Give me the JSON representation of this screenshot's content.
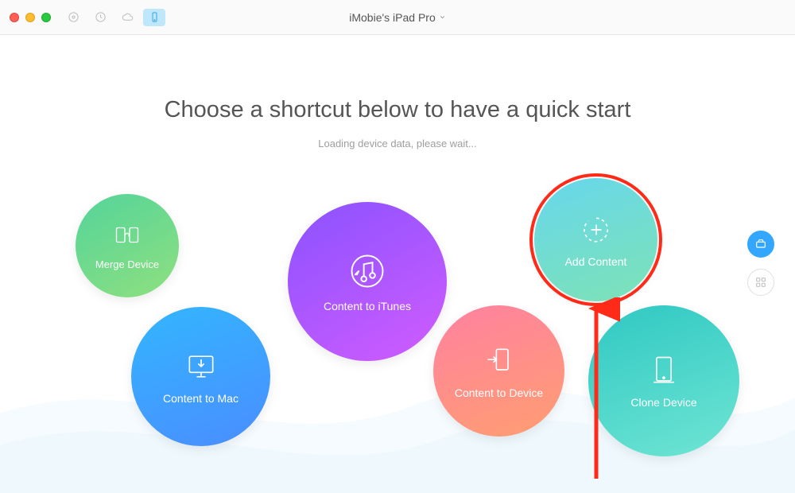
{
  "window": {
    "title": "iMobie's iPad Pro"
  },
  "toolbar": {
    "icons": [
      "disc",
      "history",
      "cloud",
      "device"
    ],
    "active_index": 3
  },
  "main": {
    "heading": "Choose a shortcut below to have a quick start",
    "subhead": "Loading device data, please wait..."
  },
  "bubbles": {
    "merge": {
      "label": "Merge Device"
    },
    "to_mac": {
      "label": "Content to Mac"
    },
    "to_itunes": {
      "label": "Content to iTunes"
    },
    "to_device": {
      "label": "Content to Device"
    },
    "add": {
      "label": "Add Content"
    },
    "clone": {
      "label": "Clone Device"
    }
  },
  "modes": {
    "active_index": 0
  },
  "colors": {
    "accent_ring": "#ff2a17",
    "mode_active": "#33a7ff"
  }
}
